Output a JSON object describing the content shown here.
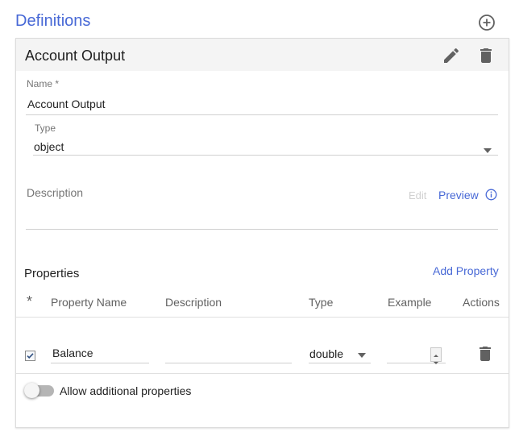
{
  "definitions": {
    "title": "Definitions",
    "add_icon": "add-circle-outline-icon"
  },
  "definition": {
    "title": "Account Output",
    "edit_icon": "pencil-icon",
    "delete_icon": "trash-icon",
    "name_label": "Name *",
    "name_value": "Account Output",
    "type_label": "Type",
    "type_value": "object",
    "description_label": "Description",
    "edit_link": "Edit",
    "preview_link": "Preview",
    "info_icon": "info-icon"
  },
  "properties": {
    "title": "Properties",
    "add_label": "Add Property",
    "columns": {
      "required": "*",
      "name": "Property Name",
      "description": "Description",
      "type": "Type",
      "example": "Example",
      "actions": "Actions"
    },
    "rows": [
      {
        "required": true,
        "name": "Balance",
        "description": "",
        "type": "double",
        "example": ""
      }
    ],
    "additional_label": "Allow additional properties",
    "additional_enabled": false
  },
  "colors": {
    "accent": "#4768d6",
    "header_bg": "#f4f4f4",
    "icon": "#616161"
  }
}
